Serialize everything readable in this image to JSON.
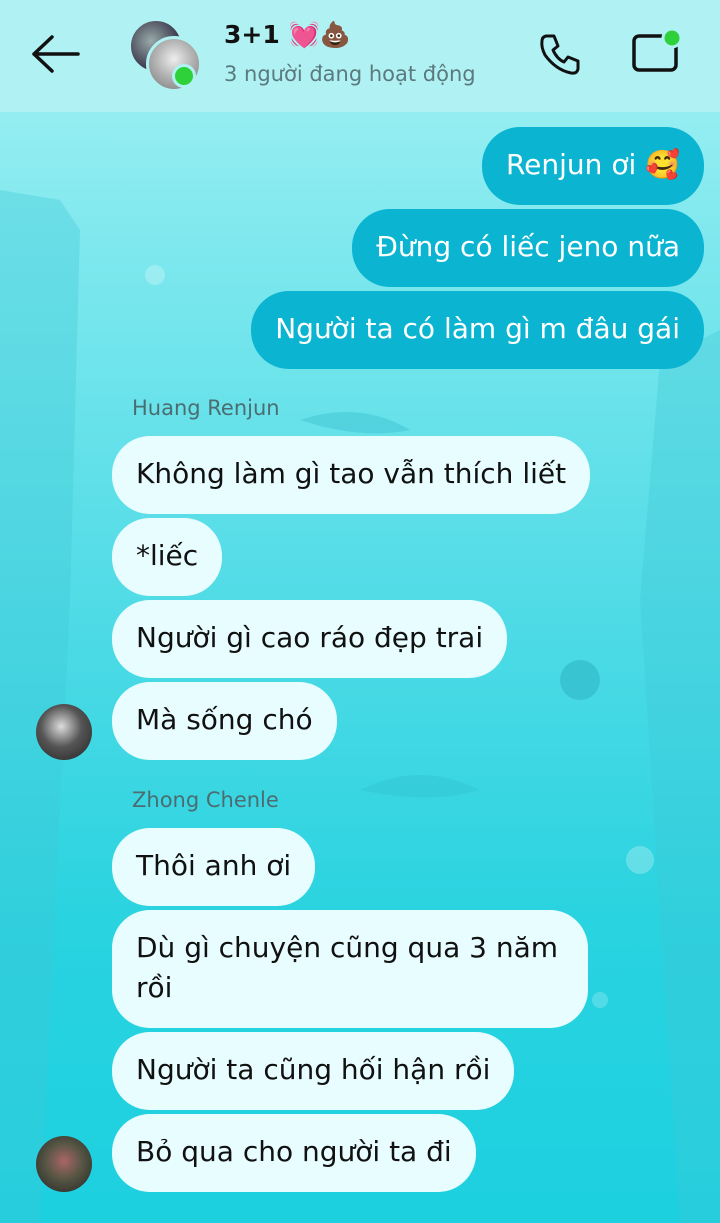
{
  "header": {
    "title": "3+1 💓💩",
    "subtitle": "3 người đang hoạt động"
  },
  "messages_out": [
    {
      "text": "Renjun ơi 🥰"
    },
    {
      "text": "Đừng có liếc jeno nữa"
    },
    {
      "text": "Người ta có làm gì m đâu gái"
    }
  ],
  "group1": {
    "sender": "Huang Renjun",
    "messages": [
      {
        "text": "Không làm gì tao vẫn thích liết"
      },
      {
        "text": "*liếc"
      },
      {
        "text": "Người gì cao ráo đẹp trai"
      },
      {
        "text": "Mà sống chó"
      }
    ]
  },
  "group2": {
    "sender": "Zhong Chenle",
    "messages": [
      {
        "text": "Thôi anh ơi"
      },
      {
        "text": "Dù gì chuyện cũng qua 3 năm"
      },
      {
        "text": "rồi"
      },
      {
        "text": "Người ta cũng hối hận rồi"
      },
      {
        "text": "Bỏ qua cho người ta đi"
      }
    ]
  },
  "colors": {
    "outgoing_bubble": "#0bb5d2",
    "incoming_bubble": "#e8fdff",
    "online": "#2fd13b"
  }
}
